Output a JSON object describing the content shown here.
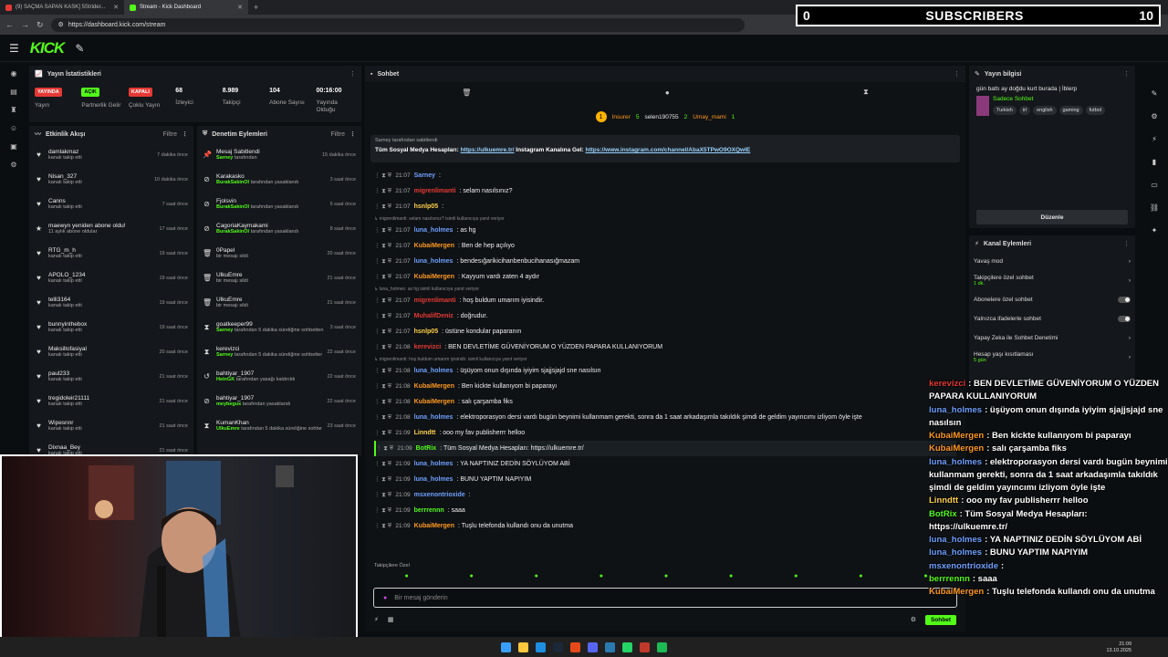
{
  "browser": {
    "tabs": [
      {
        "title": "(9) SAÇMA SAPAN KASK] 5Strider...",
        "active": false
      },
      {
        "title": "Stream - Kick Dashboard",
        "active": true
      }
    ],
    "url": "https://dashboard.kick.com/stream"
  },
  "kick": {
    "logo": "KICK"
  },
  "overlay": {
    "subs_left": "0",
    "subs_label": "SUBSCRIBERS",
    "subs_right": "10"
  },
  "stats_panel": {
    "title": "Yayın İstatistikleri",
    "stats": [
      {
        "badge": "YAYINDA",
        "badge_color": "#e53935",
        "badge_text_color": "#ffffff",
        "label": "Yayın"
      },
      {
        "badge": "AÇIK",
        "badge_color": "#53fc18",
        "badge_text_color": "#000000",
        "label": "Partnerlik Gelir"
      },
      {
        "badge": "KAPALI",
        "badge_color": "#e53935",
        "badge_text_color": "#ffffff",
        "label": "Çoklu Yayın"
      },
      {
        "value": "68",
        "label": "İzleyici"
      },
      {
        "value": "8.989",
        "label": "Takipçi"
      },
      {
        "value": "104",
        "label": "Abone Sayısı"
      },
      {
        "value": "00:16:00",
        "label": "Yayında Olduğu"
      }
    ]
  },
  "activity": {
    "title": "Etkinlik Akışı",
    "filter": "Filtre",
    "items": [
      {
        "icon": "♥",
        "name": "damlakmaz",
        "sub": "kanalı takip etti",
        "time": "7 dakika önce"
      },
      {
        "icon": "♥",
        "name": "Nisan_327",
        "sub": "kanalı takip etti",
        "time": "10 dakika önce"
      },
      {
        "icon": "♥",
        "name": "Canns",
        "sub": "kanalı takip etti",
        "time": "7 saat önce"
      },
      {
        "icon": "★",
        "name": "maewyn yeniden abone oldu!",
        "sub": "11 aylık abone oldular",
        "time": "17 saat önce"
      },
      {
        "icon": "♥",
        "name": "RTG_m_h",
        "sub": "kanalı takip etti",
        "time": "19 saat önce"
      },
      {
        "icon": "♥",
        "name": "APOLO_1234",
        "sub": "kanalı takip etti",
        "time": "19 saat önce"
      },
      {
        "icon": "♥",
        "name": "telli3164",
        "sub": "kanalı takip etti",
        "time": "19 saat önce"
      },
      {
        "icon": "♥",
        "name": "bunnyinthebox",
        "sub": "kanalı takip etti",
        "time": "19 saat önce"
      },
      {
        "icon": "♥",
        "name": "Maksillofasiyal",
        "sub": "kanalı takip etti",
        "time": "20 saat önce"
      },
      {
        "icon": "♥",
        "name": "paul233",
        "sub": "kanalı takip etti",
        "time": "21 saat önce"
      },
      {
        "icon": "♥",
        "name": "tregidoleir21111",
        "sub": "kanalı takip etti",
        "time": "21 saat önce"
      },
      {
        "icon": "♥",
        "name": "Wipesnnr",
        "sub": "kanalı takip etti",
        "time": "21 saat önce"
      },
      {
        "icon": "♥",
        "name": "Dixnaa_Bey",
        "sub": "kanalı takip etti",
        "time": "21 saat önce"
      }
    ]
  },
  "moderation": {
    "title": "Denetim Eylemleri",
    "filter": "Filtre",
    "items": [
      {
        "icon": "📌",
        "name": "Mesaj Sabitlendi",
        "who": "Sarney",
        "sub": "tarafından",
        "time": "15 dakika önce"
      },
      {
        "icon": "⊘",
        "name": "Karakasko",
        "who": "BurakSakinOl",
        "sub": "tarafından yasaklandı",
        "time": "3 saat önce"
      },
      {
        "icon": "⊘",
        "name": "Fjolsvin",
        "who": "BurakSakinOl",
        "sub": "tarafından yasaklandı",
        "time": "5 saat önce"
      },
      {
        "icon": "⊘",
        "name": "CagoriaKaymakami",
        "who": "BurakSakinOl",
        "sub": "tarafından yasaklandı",
        "time": "8 saat önce"
      },
      {
        "icon": "🗑",
        "name": "0Papel",
        "who": "",
        "sub": "bir mesajı sildi",
        "time": "20 saat önce"
      },
      {
        "icon": "🗑",
        "name": "UlkuEmre",
        "who": "",
        "sub": "bir mesajı sildi",
        "time": "21 saat önce"
      },
      {
        "icon": "🗑",
        "name": "UlkuEmre",
        "who": "",
        "sub": "bir mesajı sildi",
        "time": "21 saat önce"
      },
      {
        "icon": "⧗",
        "name": "goatkeeper99",
        "who": "Sarney",
        "sub": "tarafından 5 dakika süreliğine sohbetten uzaklaştırıldı",
        "time": "3 saat önce"
      },
      {
        "icon": "⧗",
        "name": "kerevizci",
        "who": "Sarney",
        "sub": "tarafından 5 dakika süreliğine sohbetten uzaklaştırıldı",
        "time": "22 saat önce"
      },
      {
        "icon": "↺",
        "name": "bahtiyar_1907",
        "who": "HeinGK",
        "sub": "tarafından yasağı kaldırıldı",
        "time": "22 saat önce"
      },
      {
        "icon": "⊘",
        "name": "bahtiyar_1907",
        "who": "meybegus",
        "sub": "tarafından yasaklandı",
        "time": "22 saat önce"
      },
      {
        "icon": "⧗",
        "name": "KumanKhan",
        "who": "UlkuEmre",
        "sub": "tarafından 5 dakika süreliğine sohbetten uzaklaştırıldı",
        "time": "23 saat önce"
      }
    ]
  },
  "chat": {
    "title": "Sohbet",
    "top": [
      {
        "name": "Insurer",
        "amount": "5"
      },
      {
        "name": "selen190755",
        "amount": "2"
      },
      {
        "name": "Umay_mami",
        "amount": "1"
      }
    ],
    "pinned": {
      "by": "Sarney tarafından sabitlendi",
      "text": "Tüm Sosyal Medya Hesapları:",
      "link1": "https://ulkuemre.tr/",
      "text2": "Instagram Kanalına Gel:",
      "link2": "https://www.instagram.com/channel/AbaX5TPwO9OXQwlE"
    },
    "messages": [
      {
        "time": "21:07",
        "user": "Sarney",
        "color": "#6ea0ff",
        "text": "",
        "type": "msg"
      },
      {
        "time": "21:07",
        "user": "migrenlimanti",
        "color": "#e53935",
        "text": "selam nasılsınız?",
        "type": "msg"
      },
      {
        "time": "21:07",
        "user": "hsnlp05",
        "color": "#ffd24a",
        "text": "",
        "type": "msg"
      },
      {
        "text": "migrenlimanti: selam nasılsınız? isimli kullanıcıya yanıt veriyor",
        "type": "ctx"
      },
      {
        "time": "21:07",
        "user": "luna_holmes",
        "color": "#6ea0ff",
        "text": "as hg",
        "type": "msg"
      },
      {
        "time": "21:07",
        "user": "KubaiMergen",
        "color": "#ff9a1f",
        "text": "Ben de hep açılıyo",
        "type": "msg"
      },
      {
        "time": "21:07",
        "user": "luna_holmes",
        "color": "#6ea0ff",
        "text": "bendesığarikicihanbenbucihanasığmazam",
        "type": "msg"
      },
      {
        "time": "21:07",
        "user": "KubaiMergen",
        "color": "#ff9a1f",
        "text": "Kayyum vardı zaten 4 aydır",
        "type": "msg"
      },
      {
        "text": "luna_holmes: as hg isimli kullanıcıya yanıt veriyor",
        "type": "ctx"
      },
      {
        "time": "21:07",
        "user": "migrenlimanti",
        "color": "#e53935",
        "text": "hoş buldum umarım iyisindir.",
        "type": "msg"
      },
      {
        "time": "21:07",
        "user": "MuhalifDeniz",
        "color": "#e53935",
        "text": "doğrudur.",
        "type": "msg"
      },
      {
        "time": "21:07",
        "user": "hsnlp05",
        "color": "#ffd24a",
        "text": "üstüne kondular paparanın",
        "type": "msg"
      },
      {
        "time": "21:08",
        "user": "kerevizci",
        "color": "#e53935",
        "text": "BEN DEVLETİME GÜVENİYORUM O YÜZDEN PAPARA KULLANIYORUM",
        "type": "msg"
      },
      {
        "text": "migrenlimanti: hoş buldum umarım iyisindir. isimli kullanıcıya yanıt veriyor",
        "type": "ctx"
      },
      {
        "time": "21:08",
        "user": "luna_holmes",
        "color": "#6ea0ff",
        "text": "üşüyom onun dışında iyiyim sjajjsjajd sne nasılsın",
        "type": "msg"
      },
      {
        "time": "21:08",
        "user": "KubaiMergen",
        "color": "#ff9a1f",
        "text": "Ben kickte kullanıyom bi paparayı",
        "type": "msg"
      },
      {
        "time": "21:08",
        "user": "KubaiMergen",
        "color": "#ff9a1f",
        "text": "salı çarşamba fiks",
        "type": "msg"
      },
      {
        "time": "21:08",
        "user": "luna_holmes",
        "color": "#6ea0ff",
        "text": "elektroporasyon dersi vardı bugün beynimi kullanmam gerekti, sonra da 1 saat arkadaşımla takıldık şimdi de geldim yayıncımı izliyom öyle işte",
        "type": "msg"
      },
      {
        "time": "21:09",
        "user": "Linndtt",
        "color": "#ffd24a",
        "text": "ooo my fav publisherrr helloo",
        "type": "msg"
      },
      {
        "time": "21:09",
        "user": "BotRix",
        "color": "#53fc18",
        "text": "Tüm Sosyal Medya Hesapları: https://ulkuemre.tr/",
        "type": "hl"
      },
      {
        "time": "21:09",
        "user": "luna_holmes",
        "color": "#6ea0ff",
        "text": "YA NAPTINIZ DEDİN SÖYLÜYOM ABİ",
        "type": "msg"
      },
      {
        "time": "21:09",
        "user": "luna_holmes",
        "color": "#6ea0ff",
        "text": "BUNU YAPTIM NAPIYIM",
        "type": "msg"
      },
      {
        "time": "21:09",
        "user": "msxenontrioxide",
        "color": "#6ea0ff",
        "text": "",
        "type": "msg"
      },
      {
        "time": "21:09",
        "user": "berrrennn",
        "color": "#53fc18",
        "text": "saaa",
        "type": "msg"
      },
      {
        "time": "21:09",
        "user": "KubaiMergen",
        "color": "#ff9a1f",
        "text": "Tuşlu telefonda kullandı onu da unutma",
        "type": "msg"
      }
    ],
    "followers_label": "Takipçilere Özel",
    "input_placeholder": "Bir mesaj gönderin",
    "send": "Sohbet"
  },
  "stream_info": {
    "title": "Yayın bilgisi",
    "stream_title": "gün battı ay doğdu kurt burada | İblerp",
    "category": "Sadece Sohbet",
    "tags": [
      "Turkish",
      "irl",
      "english",
      "gaming",
      "futbol"
    ],
    "edit": "Düzenle"
  },
  "channel_actions": {
    "title": "Kanal Eylemleri",
    "rows": [
      {
        "label": "Yavaş mod",
        "sub": ""
      },
      {
        "label": "Takipçilere özel sohbet",
        "sub": "1 dk."
      },
      {
        "label": "Abonelere özel sohbet",
        "sub": ""
      },
      {
        "label": "Yalnızca ifadelerle sohbet",
        "sub": ""
      },
      {
        "label": "Yapay Zeka ile Sohbet Denetimi",
        "sub": ""
      },
      {
        "label": "Hesap yaşı kısıtlaması",
        "sub": "5 gün"
      }
    ]
  },
  "overlay_chat": [
    {
      "user": "kerevizci",
      "color": "#e53935",
      "text": ": BEN DEVLETİME GÜVENİYORUM O YÜZDEN PAPARA KULLANIYORUM"
    },
    {
      "user": "luna_holmes",
      "color": "#6ea0ff",
      "text": ": üşüyom onun dışında iyiyim sjajjsjajd sne nasılsın"
    },
    {
      "user": "KubaiMergen",
      "color": "#ff9a1f",
      "text": ": Ben kickte kullanıyom bi paparayı"
    },
    {
      "user": "KubaiMergen",
      "color": "#ff9a1f",
      "text": ": salı çarşamba fiks"
    },
    {
      "user": "luna_holmes",
      "color": "#6ea0ff",
      "text": ": elektroporasyon dersi vardı bugün beynimi kullanmam gerekti, sonra da 1 saat arkadaşımla takıldık şimdi de geldim yayıncımı izliyom öyle işte"
    },
    {
      "user": "Linndtt",
      "color": "#ffd24a",
      "text": ": ooo my fav publisherrr helloo"
    },
    {
      "user": "BotRix",
      "color": "#53fc18",
      "text": ": Tüm Sosyal Medya Hesapları: https://ulkuemre.tr/"
    },
    {
      "user": "luna_holmes",
      "color": "#6ea0ff",
      "text": ": YA NAPTINIZ DEDİN SÖYLÜYOM ABİ"
    },
    {
      "user": "luna_holmes",
      "color": "#6ea0ff",
      "text": ": BUNU YAPTIM NAPIYIM"
    },
    {
      "user": "msxenontrioxide",
      "color": "#6ea0ff",
      "text": ":"
    },
    {
      "user": "berrrennn",
      "color": "#53fc18",
      "text": ": saaa"
    },
    {
      "user": "KubaiMergen",
      "color": "#ff9a1f",
      "text": ": Tuşlu telefonda kullandı onu da unutma"
    }
  ],
  "taskbar": {
    "time": "21:09",
    "date": "13.10.2025"
  },
  "colors": {
    "accent": "#53fc18",
    "live": "#e53935"
  }
}
